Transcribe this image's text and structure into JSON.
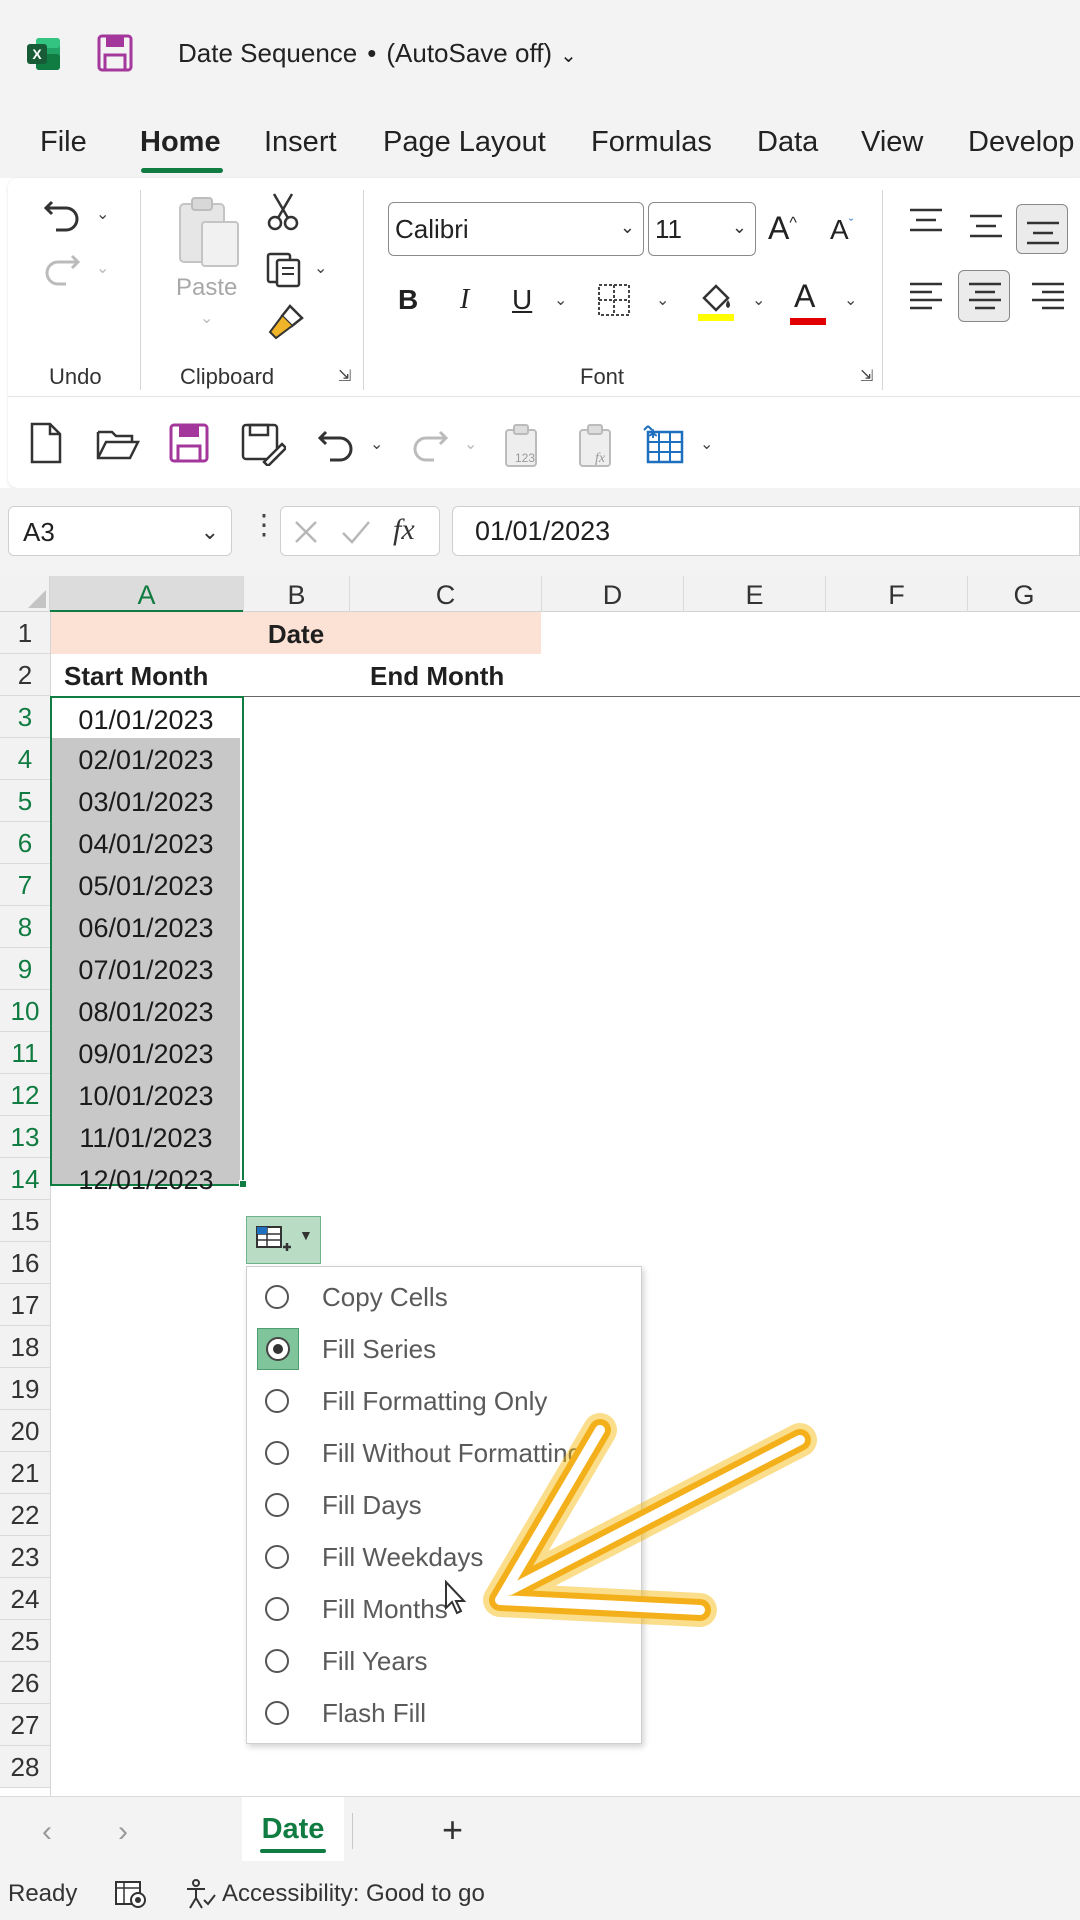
{
  "title_bar": {
    "doc_name": "Date Sequence",
    "bullet": "•",
    "autosave": "(AutoSave off)"
  },
  "ribbon_tabs": [
    "File",
    "Home",
    "Insert",
    "Page Layout",
    "Formulas",
    "Data",
    "View",
    "Develop"
  ],
  "ribbon": {
    "paste_label": "Paste",
    "groups": {
      "undo": "Undo",
      "clipboard": "Clipboard",
      "font": "Font"
    },
    "font_name": "Calibri",
    "font_size": "11",
    "bold": "B",
    "italic": "I",
    "underline": "U",
    "grow_font": "A",
    "shrink_font": "A",
    "font_color_letter": "A",
    "accent_color": "#107c41",
    "highlight_color": "#ffff00",
    "font_color": "#e00000"
  },
  "formula_bar": {
    "name_box": "A3",
    "fx": "fx",
    "value": "01/01/2023"
  },
  "grid": {
    "columns": [
      "A",
      "B",
      "C",
      "D",
      "E",
      "F",
      "G"
    ],
    "rows": [
      "1",
      "2",
      "3",
      "4",
      "5",
      "6",
      "7",
      "8",
      "9",
      "10",
      "11",
      "12",
      "13",
      "14",
      "15",
      "16",
      "17",
      "18",
      "19",
      "20",
      "21",
      "22",
      "23",
      "24",
      "25",
      "26",
      "27",
      "28"
    ],
    "date_header": "Date",
    "start_month": "Start Month",
    "end_month": "End Month",
    "dates": [
      "01/01/2023",
      "02/01/2023",
      "03/01/2023",
      "04/01/2023",
      "05/01/2023",
      "06/01/2023",
      "07/01/2023",
      "08/01/2023",
      "09/01/2023",
      "10/01/2023",
      "11/01/2023",
      "12/01/2023"
    ],
    "header_fill": "#fbe2d5"
  },
  "autofill_menu": {
    "items": [
      "Copy Cells",
      "Fill Series",
      "Fill Formatting Only",
      "Fill Without Formatting",
      "Fill Days",
      "Fill Weekdays",
      "Fill Months",
      "Fill Years",
      "Flash Fill"
    ],
    "selected": "Fill Series"
  },
  "sheet_tabs": {
    "active": "Date",
    "add": "+"
  },
  "status_bar": {
    "ready": "Ready",
    "accessibility": "Accessibility: Good to go"
  }
}
